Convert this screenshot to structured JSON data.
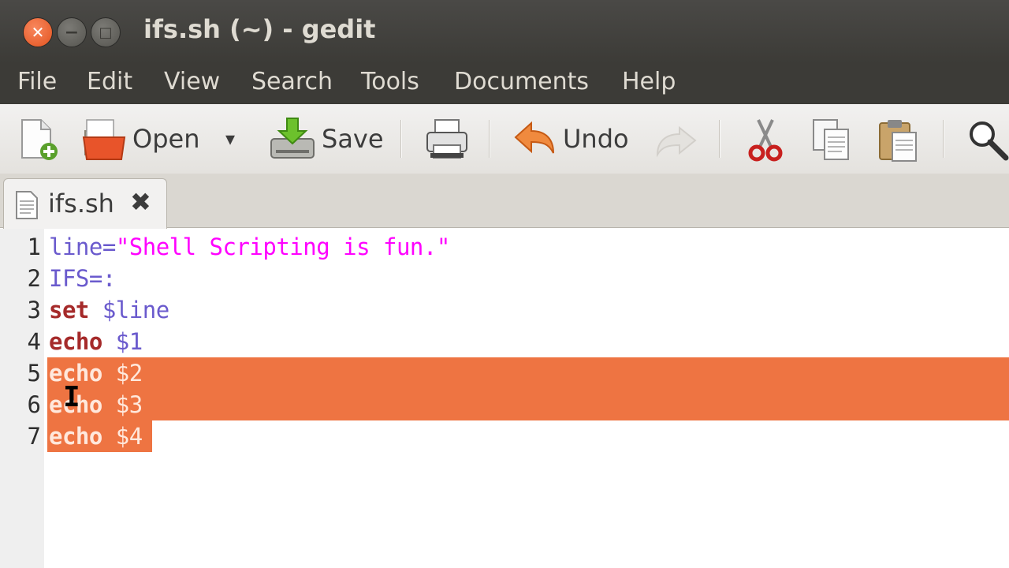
{
  "window": {
    "title": "ifs.sh (~) - gedit",
    "close_glyph": "✕",
    "minimize_glyph": "−",
    "maximize_glyph": "□"
  },
  "menu": {
    "items": [
      "File",
      "Edit",
      "View",
      "Search",
      "Tools",
      "Documents",
      "Help"
    ]
  },
  "toolbar": {
    "new_icon": "new-document-icon",
    "open_label": "Open",
    "open_dropdown_glyph": "▾",
    "save_label": "Save",
    "print_icon": "printer-icon",
    "undo_label": "Undo",
    "redo_icon": "redo-icon",
    "cut_icon": "scissors-icon",
    "copy_icon": "copy-icon",
    "paste_icon": "paste-icon",
    "search_icon": "search-icon"
  },
  "tab": {
    "label": "ifs.sh",
    "close_glyph": "✖"
  },
  "editor": {
    "line_numbers": [
      "1",
      "2",
      "3",
      "4",
      "5",
      "6",
      "7"
    ],
    "lines": [
      {
        "kw": "",
        "var": "line=",
        "str": "\"Shell Scripting is fun.\""
      },
      {
        "kw": "",
        "var": "IFS=:",
        "str": ""
      },
      {
        "kw": "set",
        "var": " $line",
        "str": ""
      },
      {
        "kw": "echo",
        "var": " $1",
        "str": ""
      },
      {
        "kw": "echo",
        "var": " $2",
        "str": ""
      },
      {
        "kw": "echo",
        "var": " $3",
        "str": ""
      },
      {
        "kw": "echo",
        "var": " $4",
        "str": ""
      }
    ],
    "selection_color": "#ee7442",
    "cursor_glyph": "I"
  },
  "colors": {
    "titlebar": "#3c3b37",
    "keyword": "#a52a2a",
    "variable": "#6a5acd",
    "string": "#ff00ff"
  }
}
